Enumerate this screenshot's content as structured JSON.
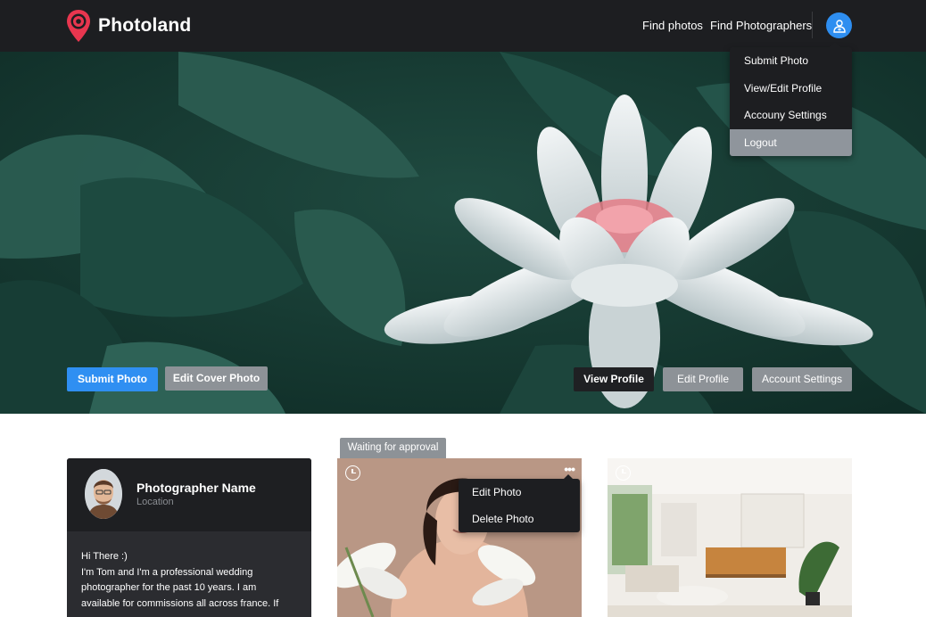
{
  "brand": {
    "name": "Photoland",
    "accent": "#e8364f"
  },
  "nav": {
    "find_photos": "Find photos",
    "find_photographers": "Find Photographers",
    "avatar_icon": "user-icon"
  },
  "user_menu": {
    "items": [
      {
        "label": "Submit Photo"
      },
      {
        "label": "View/Edit Profile"
      },
      {
        "label": "Accouny Settings"
      },
      {
        "label": "Logout"
      }
    ]
  },
  "hero": {
    "submit_photo": "Submit Photo",
    "edit_cover_photo": "Edit Cover Photo",
    "view_profile": "View Profile",
    "edit_profile": "Edit Profile",
    "account_settings": "Account Settings"
  },
  "profile": {
    "name": "Photographer Name",
    "location": "Location",
    "bio_line1": "Hi There :)",
    "bio_line2": "I'm Tom and I'm a professional wedding",
    "bio_line3": "photographer for the past 10 years. I am",
    "bio_line4": "available for commissions all across france. If"
  },
  "photos": {
    "status_label": "Waiting for approval",
    "card_menu": {
      "edit": "Edit Photo",
      "delete": "Delete Photo"
    }
  },
  "colors": {
    "primary": "#2f8ff2",
    "secondary": "#8d9297",
    "dark": "#1d1e21"
  }
}
